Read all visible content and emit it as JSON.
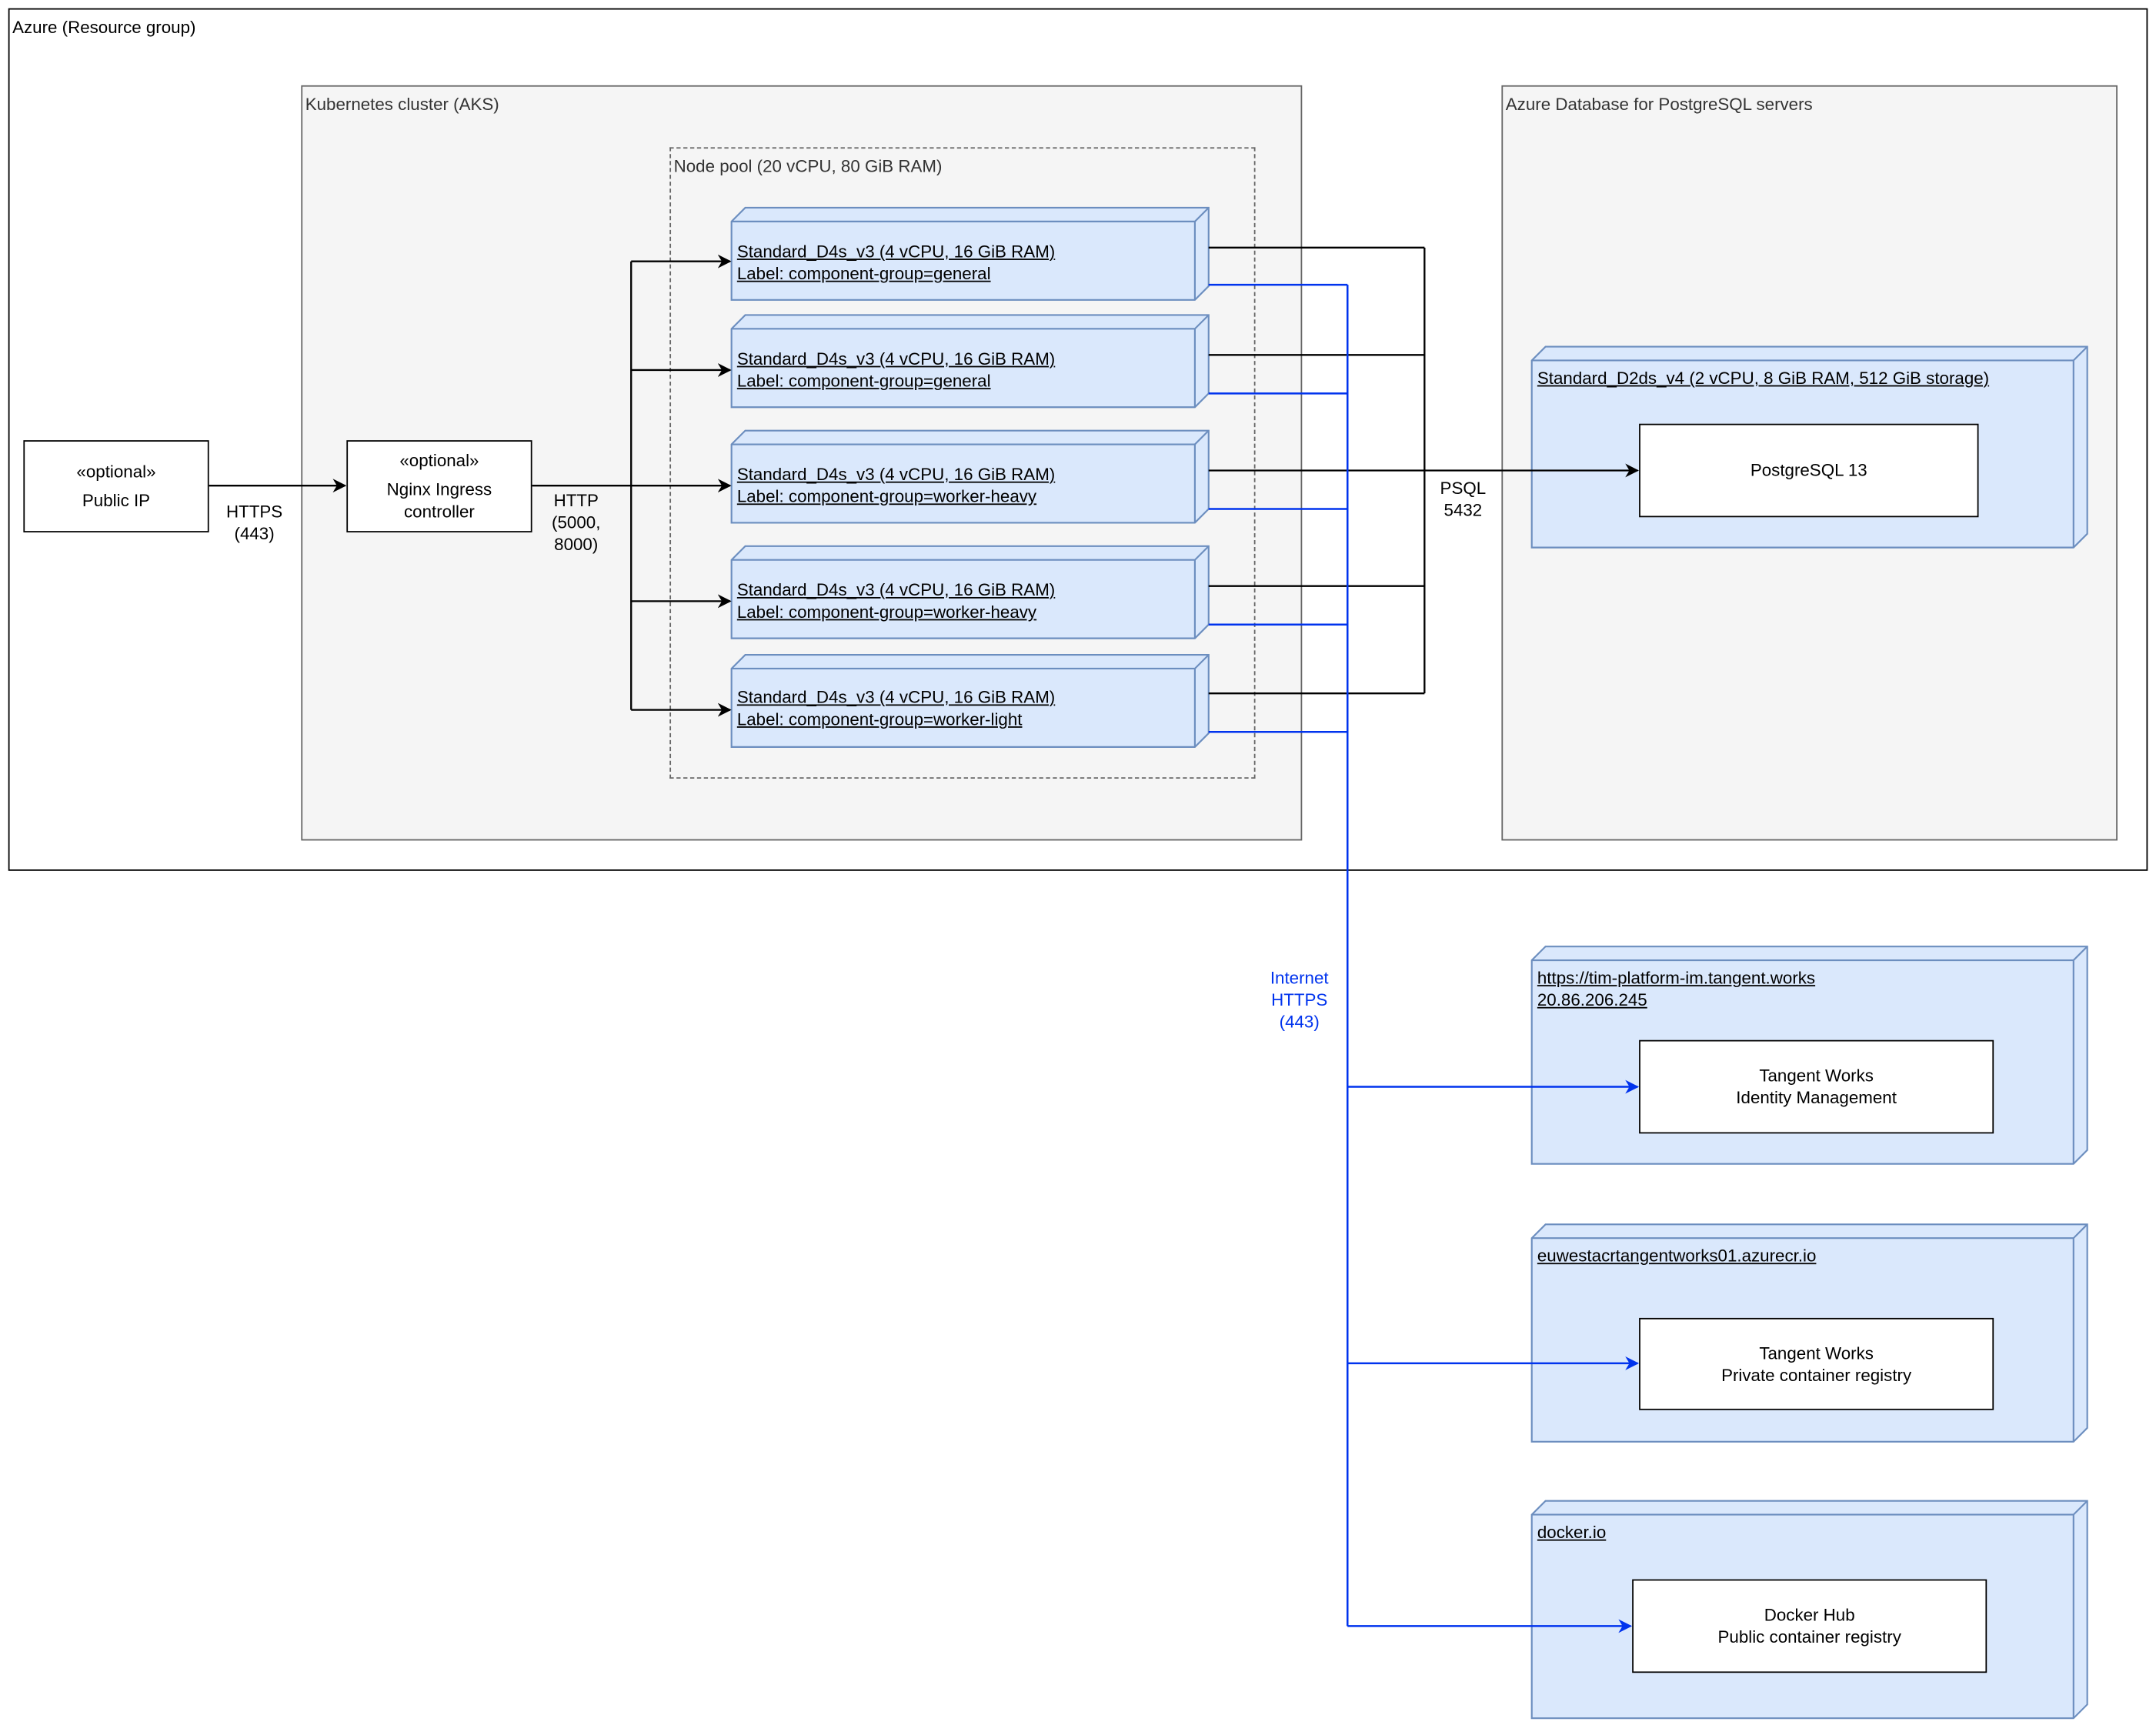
{
  "containers": {
    "resource_group": "Azure (Resource group)",
    "aks_cluster": "Kubernetes cluster (AKS)",
    "node_pool": "Node pool (20 vCPU, 80 GiB RAM)",
    "postgres_servers": "Azure Database for PostgreSQL servers"
  },
  "public_ip": {
    "stereotype": "«optional»",
    "name": "Public IP"
  },
  "ingress": {
    "stereotype": "«optional»",
    "name_line1": "Nginx Ingress",
    "name_line2": "controller"
  },
  "nodes": [
    {
      "vm": "Standard_D4s_v3 (4 vCPU, 16 GiB RAM)",
      "label": "Label: component-group=general"
    },
    {
      "vm": "Standard_D4s_v3 (4 vCPU, 16 GiB RAM)",
      "label": "Label: component-group=general"
    },
    {
      "vm": "Standard_D4s_v3 (4 vCPU, 16 GiB RAM)",
      "label": "Label: component-group=worker-heavy"
    },
    {
      "vm": "Standard_D4s_v3 (4 vCPU, 16 GiB RAM)",
      "label": "Label: component-group=worker-heavy"
    },
    {
      "vm": "Standard_D4s_v3 (4 vCPU, 16 GiB RAM)",
      "label": "Label: component-group=worker-light"
    }
  ],
  "postgres": {
    "vm": "Standard_D2ds_v4 (2 vCPU, 8 GiB RAM, 512 GiB storage)",
    "service": "PostgreSQL 13"
  },
  "external": [
    {
      "host_line1": "https://tim-platform-im.tangent.works",
      "host_line2": "20.86.206.245",
      "service_line1": "Tangent Works",
      "service_line2": "Identity Management"
    },
    {
      "host_line1": "euwestacrtangentworks01.azurecr.io",
      "host_line2": "",
      "service_line1": "Tangent Works",
      "service_line2": "Private container registry"
    },
    {
      "host_line1": "docker.io",
      "host_line2": "",
      "service_line1": "Docker Hub",
      "service_line2": "Public container registry"
    }
  ],
  "edge_labels": {
    "https": {
      "line1": "HTTPS",
      "line2": "(443)"
    },
    "http": {
      "line1": "HTTP",
      "line2": "(5000,",
      "line3": "8000)"
    },
    "psql": {
      "line1": "PSQL",
      "line2": "5432"
    },
    "internet": {
      "line1": "Internet",
      "line2": "HTTPS",
      "line3": "(443)"
    }
  },
  "colors": {
    "node_fill": "#dae8fc",
    "node_stroke": "#6c8ebf",
    "internet_edge": "#0033ee",
    "container_fill": "#f5f5f5"
  }
}
